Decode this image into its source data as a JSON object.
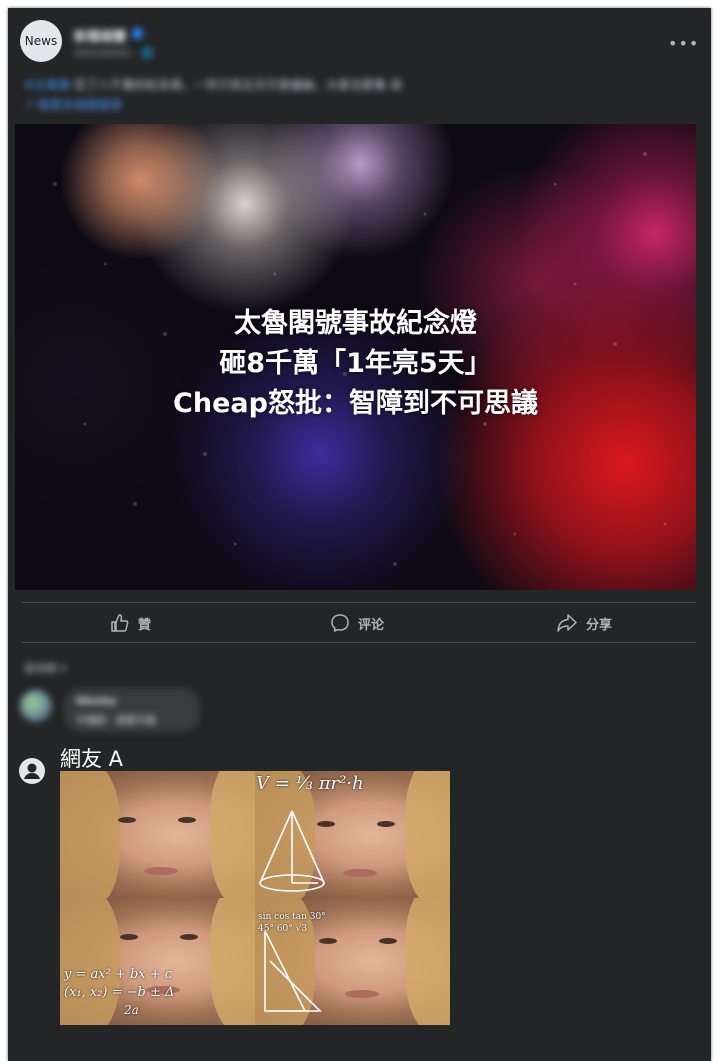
{
  "post": {
    "page_avatar_text": "News",
    "page_name": "新聞媒體",
    "timestamp": "2022/02/01 · 🌐",
    "more_icon": "more-icon",
    "text_line1_tag": "#太魯閣",
    "text_line1": " 花了八千萬的紀念燈，一年只亮五天引發議論，大家怎麼看 😅",
    "text_line2": "↗ 看更多相關報導",
    "hero_title_lines": [
      "太魯閣號事故紀念燈",
      "砸8千萬「1年亮5天」",
      "Cheap怒批：智障到不可思議"
    ]
  },
  "actions": {
    "like_label": "贊",
    "comment_label": "评论",
    "share_label": "分享"
  },
  "comments": {
    "sort_label": "最相關 ▾",
    "blurred_name": "Wesley",
    "blurred_text": "不懂耶 · 感覺不錯",
    "commenter_name": "網友 A",
    "meme_formula_top": "V = ⅓ πr²·h",
    "meme_formula_bottom_1": "y = ax² + bx + c",
    "meme_formula_bottom_2": "(x₁, x₂) = −b ± Δ",
    "meme_formula_bottom_3": "2a",
    "meme_table": "sin cos tan 30° 45° 60° √3"
  },
  "colors": {
    "card_bg": "#242526",
    "text_primary": "#e4e6eb",
    "text_secondary": "#b0b3b8",
    "link": "#4599ff"
  }
}
